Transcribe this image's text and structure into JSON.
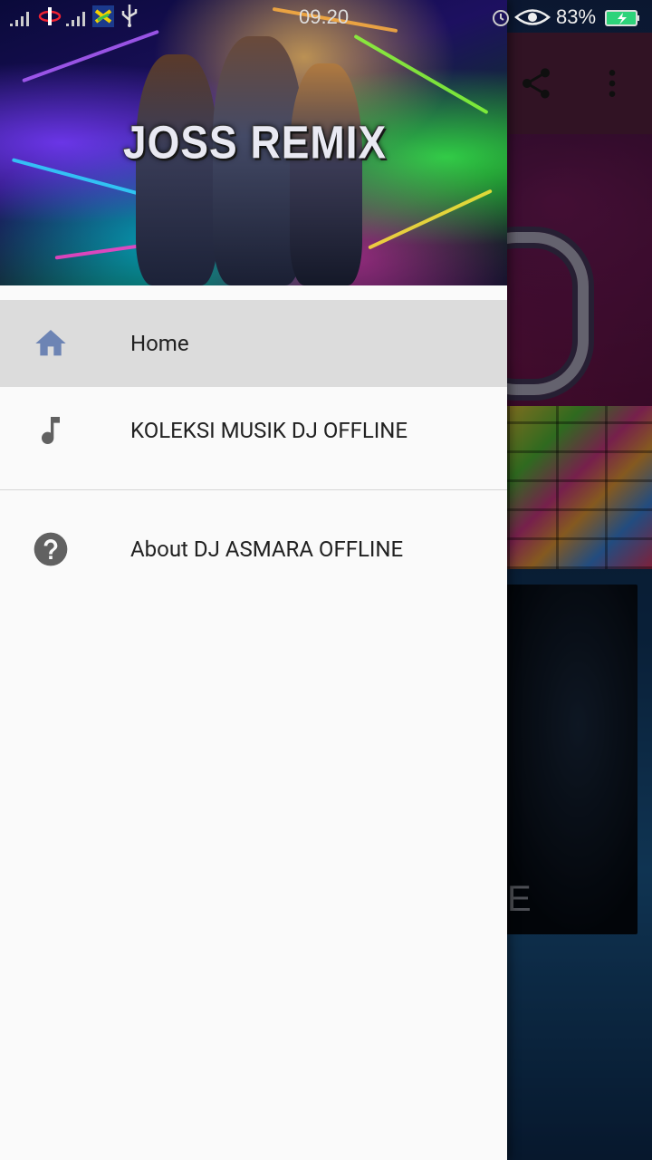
{
  "status_bar": {
    "time": "09.20",
    "battery_percent": "83%"
  },
  "drawer": {
    "header_logo": "JOSS REMIX",
    "items": [
      {
        "label": "Home",
        "icon": "home-icon",
        "active": true
      },
      {
        "label": "KOLEKSI MUSIK DJ OFFLINE",
        "icon": "music-note-icon",
        "active": false
      },
      {
        "label": "About DJ ASMARA  OFFLINE",
        "icon": "help-icon",
        "active": false
      }
    ]
  },
  "background_app": {
    "card_partial_text": "E",
    "toolbar_color": "#5a2343"
  },
  "colors": {
    "drawer_bg": "#fafafa",
    "active_item_bg": "#dcdcdc",
    "home_icon": "#6d84b4",
    "icon_gray": "#616161"
  }
}
